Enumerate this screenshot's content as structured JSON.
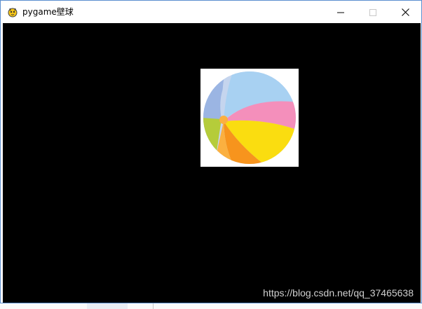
{
  "window": {
    "title": "pygame壁球",
    "icon": "pygame-snake-icon",
    "controls": {
      "minimize_icon": "minimize-icon",
      "maximize_icon": "maximize-icon",
      "close_icon": "close-icon"
    }
  },
  "canvas": {
    "background": "#000000",
    "ball": {
      "name": "beach-ball-image",
      "colors": [
        "#a8d1f2",
        "#f48fbb",
        "#fadd10",
        "#f7941d",
        "#fbb040",
        "#b5cc3a",
        "#9bb5e3",
        "#c5d5ee"
      ]
    }
  },
  "watermark": {
    "text": "https://blog.csdn.net/qq_37465638"
  },
  "colors": {
    "window_border": "#5b8fd0",
    "titlebar": "#ffffff"
  }
}
